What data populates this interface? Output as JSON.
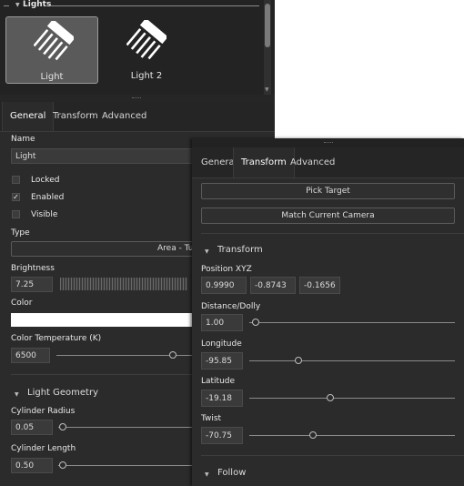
{
  "lights_section": {
    "title": "Lights"
  },
  "lights": [
    {
      "label": "Light",
      "selected": true
    },
    {
      "label": "Light 2",
      "selected": false
    }
  ],
  "left_panel": {
    "tabs": [
      "General",
      "Transform",
      "Advanced"
    ],
    "active_tab": "General",
    "name_label": "Name",
    "name_value": "Light",
    "locked_label": "Locked",
    "enabled_label": "Enabled",
    "visible_label": "Visible",
    "locked_checked": false,
    "enabled_checked": true,
    "visible_checked": false,
    "check_glyph": "✓",
    "type_label": "Type",
    "type_value": "Area - Tube",
    "brightness_label": "Brightness",
    "brightness_value": "7.25",
    "color_label": "Color",
    "color_value": "#ffffff",
    "color_temp_label": "Color Temperature (K)",
    "color_temp_value": "6500",
    "light_geometry_label": "Light Geometry",
    "cyl_radius_label": "Cylinder Radius",
    "cyl_radius_value": "0.05",
    "cyl_length_label": "Cylinder Length",
    "cyl_length_value": "0.50"
  },
  "right_panel": {
    "tabs": [
      "General",
      "Transform",
      "Advanced"
    ],
    "active_tab": "Transform",
    "pick_target_label": "Pick Target",
    "match_camera_label": "Match Current Camera",
    "transform_section": "Transform",
    "position_label": "Position XYZ",
    "position": [
      "0.9990",
      "-0.8743",
      "-0.1656"
    ],
    "distance_label": "Distance/Dolly",
    "distance_value": "1.00",
    "longitude_label": "Longitude",
    "longitude_value": "-95.85",
    "latitude_label": "Latitude",
    "latitude_value": "-19.18",
    "twist_label": "Twist",
    "twist_value": "-70.75",
    "follow_section": "Follow"
  },
  "icons": {
    "light": "light-icon",
    "collapse": "triangle-down-icon",
    "checkmark": "checkmark-icon"
  }
}
